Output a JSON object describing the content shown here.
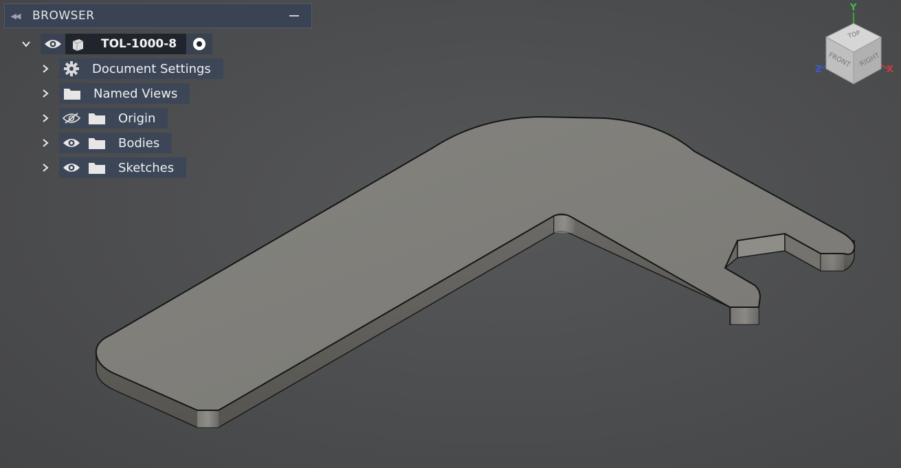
{
  "browser": {
    "title": "BROWSER",
    "root": {
      "name": "TOL-1000-8"
    },
    "items": [
      {
        "label": "Document Settings",
        "icon": "gear-icon",
        "has_visibility": false
      },
      {
        "label": "Named Views",
        "icon": "folder-icon",
        "has_visibility": false
      },
      {
        "label": "Origin",
        "icon": "folder-icon",
        "has_visibility": true,
        "visible": false
      },
      {
        "label": "Bodies",
        "icon": "folder-icon",
        "has_visibility": true,
        "visible": true
      },
      {
        "label": "Sketches",
        "icon": "folder-icon",
        "has_visibility": true,
        "visible": true
      }
    ]
  },
  "viewcube": {
    "faces": {
      "top": "TOP",
      "front": "FRONT",
      "right": "RIGHT"
    },
    "axes": {
      "y": "Y",
      "z": "Z",
      "x": "X"
    },
    "axis_colors": {
      "x": "#d23a3a",
      "y": "#3fbf3f",
      "z": "#3a5bd2"
    }
  },
  "colors": {
    "background": "#4d4e50",
    "part_top": "#807f7a",
    "part_side": "#5f5e5b",
    "panel_header": "#3a4353",
    "panel_row": "#3d4657"
  }
}
